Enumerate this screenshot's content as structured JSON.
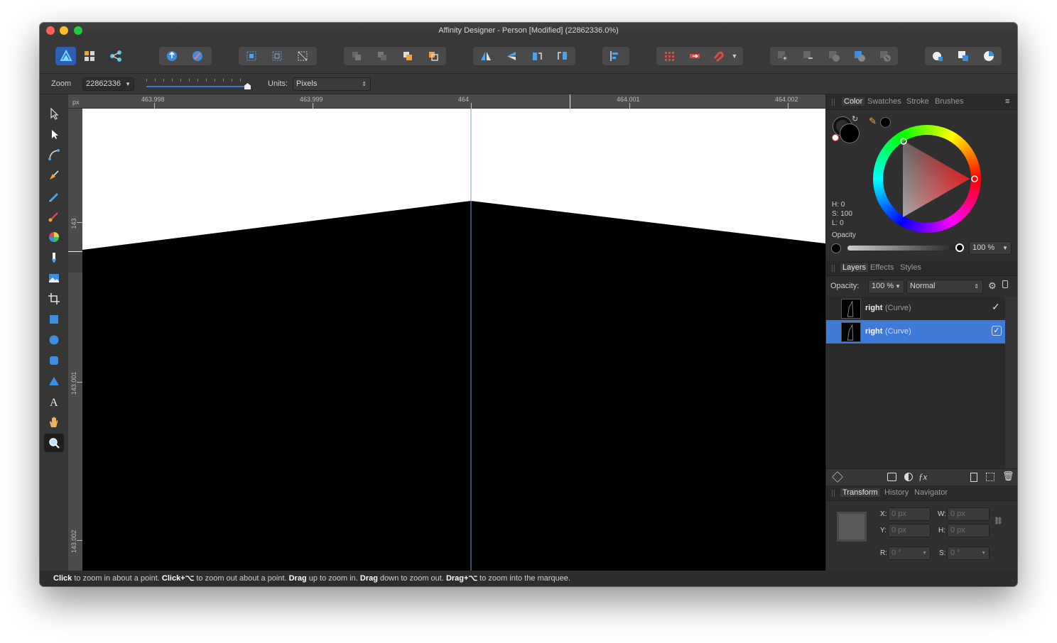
{
  "window": {
    "title": "Affinity Designer - Person [Modified] (22862336.0%)"
  },
  "context_bar": {
    "zoom_label": "Zoom",
    "zoom_value": "22862336",
    "units_label": "Units:",
    "units_value": "Pixels"
  },
  "rulers": {
    "unit": "px",
    "top_ticks": [
      "463.998",
      "463.999",
      "464",
      "464.001",
      "464.002"
    ],
    "left_ticks": [
      "143",
      "143.001",
      "143.002"
    ]
  },
  "color_panel": {
    "tabs": [
      "Color",
      "Swatches",
      "Stroke",
      "Brushes"
    ],
    "h": "H: 0",
    "s": "S: 100",
    "l": "L: 0",
    "opacity_label": "Opacity",
    "opacity_value": "100 %"
  },
  "layers_panel": {
    "tabs": [
      "Layers",
      "Effects",
      "Styles"
    ],
    "opacity_label": "Opacity:",
    "opacity_value": "100 %",
    "blend_mode": "Normal",
    "layers": [
      {
        "name": "right",
        "type": "(Curve)",
        "selected": false
      },
      {
        "name": "right",
        "type": "(Curve)",
        "selected": true
      }
    ]
  },
  "transform_panel": {
    "tabs": [
      "Transform",
      "History",
      "Navigator"
    ],
    "x_label": "X:",
    "x_value": "0 px",
    "y_label": "Y:",
    "y_value": "0 px",
    "w_label": "W:",
    "w_value": "0 px",
    "h_label": "H:",
    "h_value": "0 px",
    "r_label": "R:",
    "r_value": "0 °",
    "s_label": "S:",
    "s_value": "0 °"
  },
  "status": {
    "b1": "Click",
    "t1": " to zoom in about a point. ",
    "b2": "Click+⌥",
    "t2": " to zoom out about a point. ",
    "b3": "Drag",
    "t3": " up to zoom in. ",
    "b4": "Drag",
    "t4": " down to zoom out. ",
    "b5": "Drag+⌥",
    "t5": " to zoom into the marquee."
  },
  "colors": {
    "accent": "#3a78d6",
    "selection": "#3f7ad8",
    "panel": "#2f2f2f"
  }
}
